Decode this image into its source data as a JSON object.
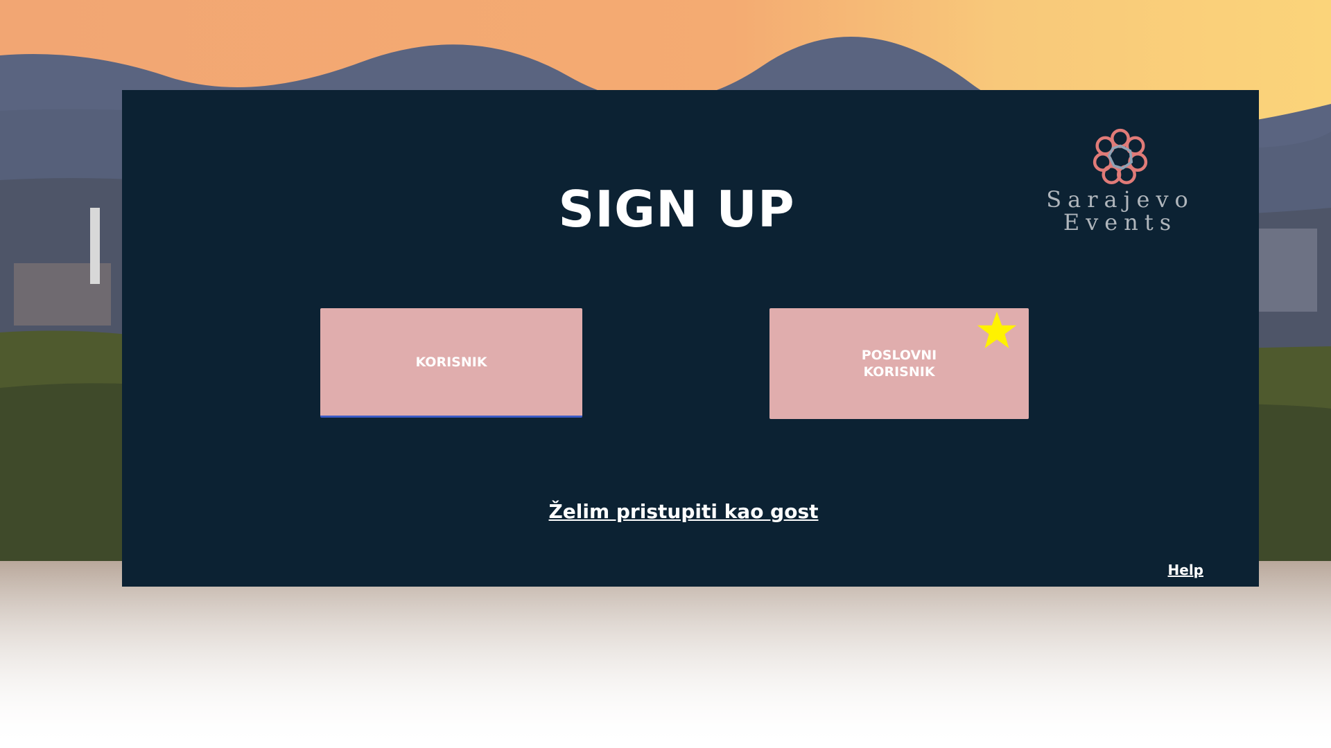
{
  "page": {
    "title": "SIGN UP",
    "accent_color": "#0c2233",
    "button_color": "#e0adad",
    "star_color": "#fff200"
  },
  "logo": {
    "icon": "knot-ornament-icon",
    "line1": "Sarajevo",
    "line2": "Events"
  },
  "buttons": {
    "user_label": "KORISNIK",
    "business_label": "POSLOVNI KORISNIK",
    "business_badge_icon": "star-icon"
  },
  "links": {
    "guest": "Želim pristupiti kao gost",
    "help": "Help"
  }
}
